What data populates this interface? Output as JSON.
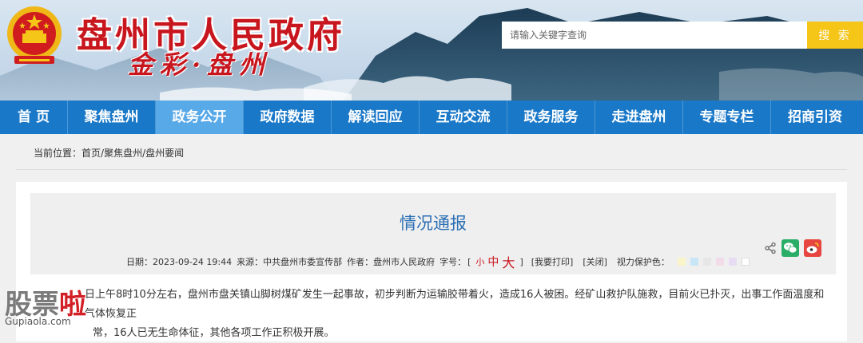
{
  "header": {
    "site_title": "盘州市人民政府",
    "slogan": "金彩·盘州",
    "search": {
      "placeholder": "请输入关键字查询",
      "button_label": "搜 索"
    }
  },
  "nav": {
    "items": [
      {
        "label": "首 页",
        "active": false
      },
      {
        "label": "聚焦盘州",
        "active": false
      },
      {
        "label": "政务公开",
        "active": true
      },
      {
        "label": "政府数据",
        "active": false
      },
      {
        "label": "解读回应",
        "active": false
      },
      {
        "label": "互动交流",
        "active": false
      },
      {
        "label": "政务服务",
        "active": false
      },
      {
        "label": "走进盘州",
        "active": false
      },
      {
        "label": "专题专栏",
        "active": false
      },
      {
        "label": "招商引资",
        "active": false
      }
    ]
  },
  "breadcrumb": {
    "prefix": "当前位置：",
    "items": [
      "首页",
      "聚焦盘州",
      "盘州要闻"
    ],
    "separator": "/"
  },
  "article": {
    "title": "情况通报",
    "meta": {
      "date_label": "日期：",
      "date": "2023-09-24 19:44",
      "source_label": "来源：",
      "source": "中共盘州市委宣传部",
      "author_label": "作者：",
      "author": "盘州市人民政府",
      "font_size_label": "字号：",
      "bracket_open": "[",
      "bracket_close": "]",
      "font_small": "小",
      "font_mid": "中",
      "font_large": "大",
      "print_label": "[我要打印]",
      "close_label": "[关闭]",
      "eye_label": "视力保护色：",
      "swatches": [
        "#f9f5c8",
        "#c8e6f5",
        "#e6e6e6",
        "#f2dcea",
        "#e8dcf2",
        "#ffffff"
      ]
    },
    "share_icons": [
      "share-icon",
      "wechat-icon",
      "weibo-icon"
    ],
    "body": [
      "日上午8时10分左右，盘州市盘关镇山脚树煤矿发生一起事故，初步判断为运输胶带着火，造成16人被困。经矿山救护队施救，目前火已扑灭，出事工作面温度和气体恢复正",
      "常，16人已无生命体征，其他各项工作正积极开展。"
    ]
  },
  "watermark": {
    "text_main": "股票",
    "text_hl": "啦",
    "url": "Gupiaola.com"
  },
  "colors": {
    "brand_red": "#c8161e",
    "nav_blue": "#1a78c8",
    "nav_active": "#58a9e8",
    "title_blue": "#2b6fb4",
    "search_yellow": "#f5c518"
  }
}
